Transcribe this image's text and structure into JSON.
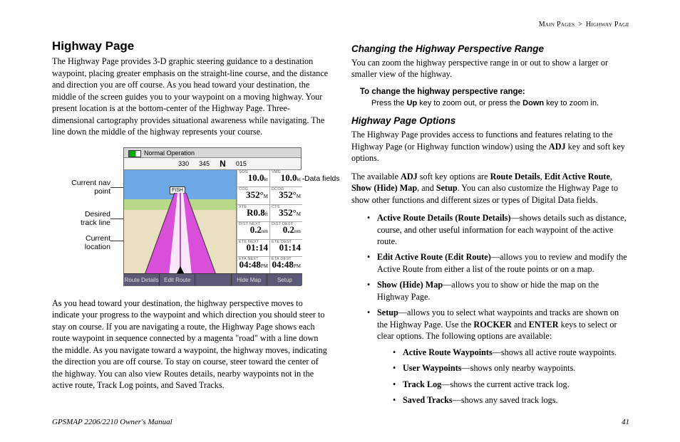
{
  "breadcrumb": {
    "a": "Main Pages",
    "sep": ">",
    "b": "Highway Page"
  },
  "left": {
    "h1": "Highway Page",
    "p1": "The Highway Page provides 3-D graphic steering guidance to a destination waypoint, placing greater emphasis on the straight-line course, and the distance and direction you are off course. As you head toward your destination, the middle of the screen guides you to your waypoint on a moving highway. Your present location is at the bottom-center of the Highway Page. Three-dimensional cartography provides situational awareness while navigating. The line down the middle of the highway represents your course.",
    "p2": "As you head toward your destination, the highway perspective moves to indicate your progress to the waypoint and which direction you should steer to stay on course. If you are navigating a route, the Highway Page shows each route waypoint in sequence connected by a magenta \"road\" with a line down the middle. As you navigate toward a waypoint, the highway moves, indicating the direction you are off course. To stay on course, steer toward the center of the highway. You can also view Routes details, nearby waypoints not in the active route, Track Log points, and Saved Tracks.",
    "callouts": {
      "navpoint": "Current nav point",
      "trackline": "Desired track line",
      "location": "Current location",
      "datafields": "Data fields"
    }
  },
  "right": {
    "h2a": "Changing the Highway Perspective Range",
    "p1": "You can zoom the highway perspective range in or out to show a larger or smaller view of the highway.",
    "stepHead": "To change the highway perspective range:",
    "stepBody_a": "Press the ",
    "stepBody_up": "Up",
    "stepBody_b": " key to zoom out, or press the ",
    "stepBody_down": "Down",
    "stepBody_c": " key to zoom in.",
    "h2b": "Highway Page Options",
    "p2a": "The Highway Page provides access to functions and features relating to the Highway Page (or Highway function window) using the ",
    "p2adj": "ADJ",
    "p2b": " key and soft key options.",
    "p3a": "The available ",
    "p3adj": "ADJ",
    "p3b": " soft key options are ",
    "p3o1": "Route Details",
    "p3o2": "Edit Active Route",
    "p3o3": "Show (Hide) Map",
    "p3o4": "Setup",
    "p3c": ". You can also customize the Highway Page to show other functions and different sizes or types of Digital Data fields.",
    "bullets": {
      "b1t": "Active Route Details (Route Details)",
      "b1d": "—shows details such as distance, course, and other useful information for each waypoint of the active route.",
      "b2t": "Edit Active Route (Edit Route)",
      "b2d": "—allows you to review and modify the Active Route from either a list of the route points or on a map.",
      "b3t": "Show (Hide) Map",
      "b3d": "—allows you to show or hide the map on the Highway Page.",
      "b4t": "Setup",
      "b4d1": "—allows you to select what waypoints and tracks are shown on the Highway Page. Use the ",
      "b4r": "ROCKER",
      "b4and": " and ",
      "b4e": "ENTER",
      "b4d2": " keys to select or clear options. The following options are available:",
      "s1t": "Active Route Waypoints",
      "s1d": "—shows all active route waypoints.",
      "s2t": "User Waypoints",
      "s2d": "—shows only nearby waypoints.",
      "s3t": "Track Log",
      "s3d": "—shows the current active track log.",
      "s4t": "Saved Tracks",
      "s4d": "—shows any saved track logs."
    }
  },
  "gps": {
    "mode": "Normal Operation",
    "compass": {
      "a": "330",
      "b": "345",
      "n": "N",
      "c": "015"
    },
    "flag": "FISH",
    "data": [
      {
        "lbl": "SOG",
        "val": "10.0",
        "unit": "kt"
      },
      {
        "lbl": "VMG",
        "val": "10.0",
        "unit": "kt"
      },
      {
        "lbl": "COG",
        "val": "352°",
        "unit": "M"
      },
      {
        "lbl": "DCOG",
        "val": "352°",
        "unit": "M"
      },
      {
        "lbl": "XTE",
        "val": "R0.8",
        "unit": "ft"
      },
      {
        "lbl": "CTS",
        "val": "352°",
        "unit": "M"
      },
      {
        "lbl": "DIST NEXT",
        "val": "0.2",
        "unit": "nm"
      },
      {
        "lbl": "DIST DEST",
        "val": "0.2",
        "unit": "nm"
      },
      {
        "lbl": "ETE NEXT",
        "val": "01:14",
        "unit": ""
      },
      {
        "lbl": "ETE DEST",
        "val": "01:14",
        "unit": ""
      },
      {
        "lbl": "ETA NEXT",
        "val": "04:48",
        "unit": "PM"
      },
      {
        "lbl": "ETA DEST",
        "val": "04:48",
        "unit": "PM"
      }
    ],
    "soft": [
      "Route Details",
      "Edit Route",
      "",
      "Hide Map",
      "Setup"
    ]
  },
  "footer": {
    "manual": "GPSMAP 2206/2210 Owner's Manual",
    "page": "41"
  }
}
